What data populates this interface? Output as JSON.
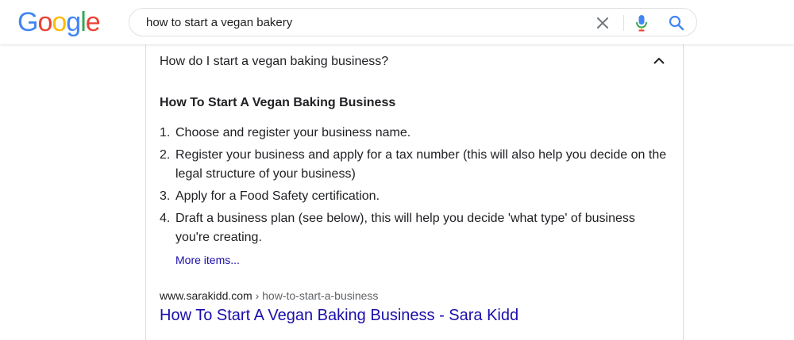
{
  "header": {
    "logo": [
      "G",
      "o",
      "o",
      "g",
      "l",
      "e"
    ],
    "logo_colors": [
      "#4285F4",
      "#EA4335",
      "#FBBC05",
      "#4285F4",
      "#34A853",
      "#EA4335"
    ],
    "search_query": "how to start a vegan bakery",
    "icons": {
      "clear": "close-icon",
      "mic": "microphone-icon",
      "search": "search-icon"
    }
  },
  "faq": {
    "question": "How do I start a vegan baking business?",
    "expanded_icon": "chevron-up-icon",
    "answer_heading": "How To Start A Vegan Baking Business",
    "steps": [
      {
        "num": "1.",
        "text": "Choose and register your business name."
      },
      {
        "num": "2.",
        "text": "Register your business and apply for a tax number (this will also help you decide on the legal structure of your business)"
      },
      {
        "num": "3.",
        "text": "Apply for a Food Safety certification."
      },
      {
        "num": "4.",
        "text": "Draft a business plan (see below), this will help you decide 'what type' of business you're creating."
      }
    ],
    "more_items": "More items...",
    "source": {
      "domain": "www.sarakidd.com",
      "path": " › how-to-start-a-business",
      "title": "How To Start A Vegan Baking Business - Sara Kidd"
    }
  },
  "colors": {
    "link": "#1a0dab",
    "text": "#202124",
    "muted": "#5f6368",
    "border": "#dadce0"
  }
}
